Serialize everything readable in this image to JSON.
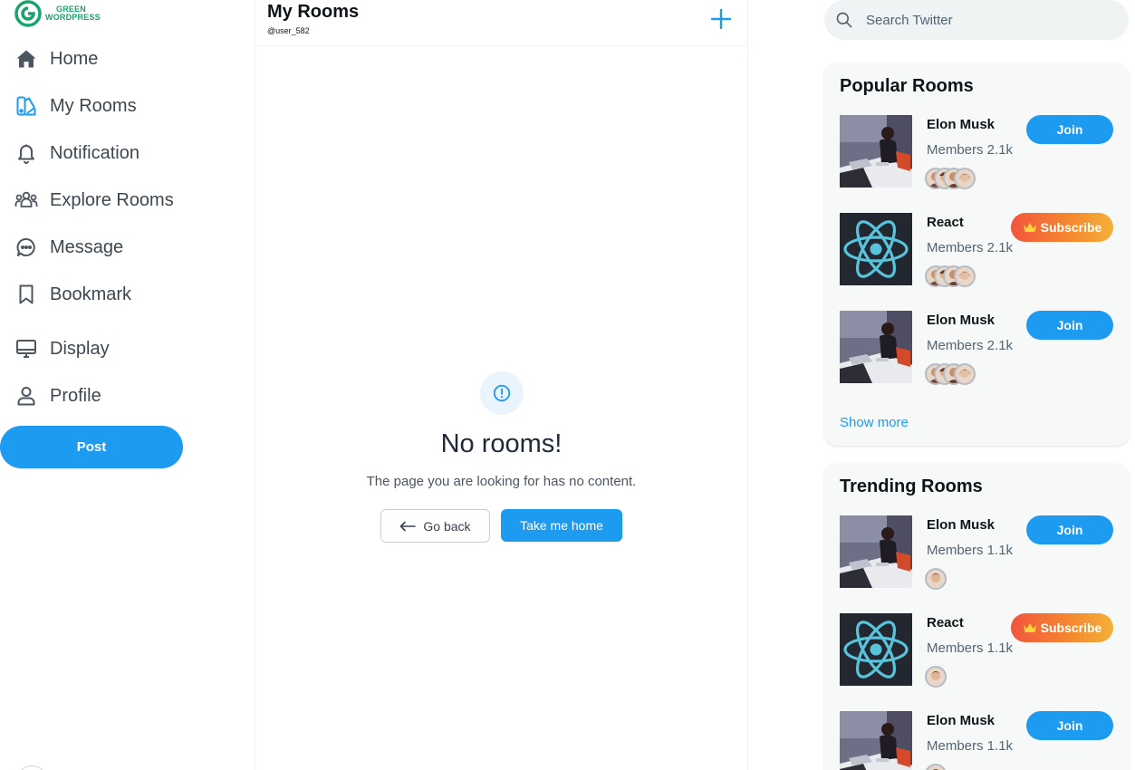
{
  "brand": {
    "line1": "GREEN",
    "line2": "WORDPRESS",
    "color": "#1aa36b"
  },
  "nav": [
    {
      "id": "home",
      "label": "Home",
      "icon": "home-icon"
    },
    {
      "id": "my-rooms",
      "label": "My Rooms",
      "icon": "rooms-icon",
      "active": true
    },
    {
      "id": "notification",
      "label": "Notification",
      "icon": "bell-icon"
    },
    {
      "id": "explore-rooms",
      "label": "Explore Rooms",
      "icon": "group-icon"
    },
    {
      "id": "message",
      "label": "Message",
      "icon": "chat-bubble-icon"
    },
    {
      "id": "bookmark",
      "label": "Bookmark",
      "icon": "bookmark-icon"
    },
    {
      "id": "display",
      "label": "Display",
      "icon": "monitor-icon"
    },
    {
      "id": "profile",
      "label": "Profile",
      "icon": "user-icon"
    }
  ],
  "post_label": "Post",
  "header": {
    "title": "My Rooms",
    "handle": "@user_582",
    "add_icon": "plus-icon"
  },
  "empty": {
    "icon": "alert-circle-icon",
    "title": "No rooms!",
    "message": "The page you are looking for has no content.",
    "back_label": "Go back",
    "home_label": "Take me home"
  },
  "search": {
    "placeholder": "Search Twitter",
    "icon": "search-icon"
  },
  "popular": {
    "title": "Popular Rooms",
    "show_more": "Show more",
    "rooms": [
      {
        "name": "Elon Musk",
        "members": "Members 2.1k",
        "action": "Join",
        "thumb": "photo"
      },
      {
        "name": "React",
        "members": "Members 2.1k",
        "action": "Subscribe",
        "thumb": "react-logo"
      },
      {
        "name": "Elon Musk",
        "members": "Members 2.1k",
        "action": "Join",
        "thumb": "photo"
      }
    ]
  },
  "trending": {
    "title": "Trending Rooms",
    "rooms": [
      {
        "name": "Elon Musk",
        "members": "Members 1.1k",
        "action": "Join",
        "thumb": "photo"
      },
      {
        "name": "React",
        "members": "Members 1.1k",
        "action": "Subscribe",
        "thumb": "react-logo"
      },
      {
        "name": "Elon Musk",
        "members": "Members 1.1k",
        "action": "Join",
        "thumb": "photo"
      }
    ]
  },
  "colors": {
    "accent": "#1d9bf0",
    "text": "#0f1419",
    "muted": "#536471",
    "panel": "#f7f9f9"
  }
}
